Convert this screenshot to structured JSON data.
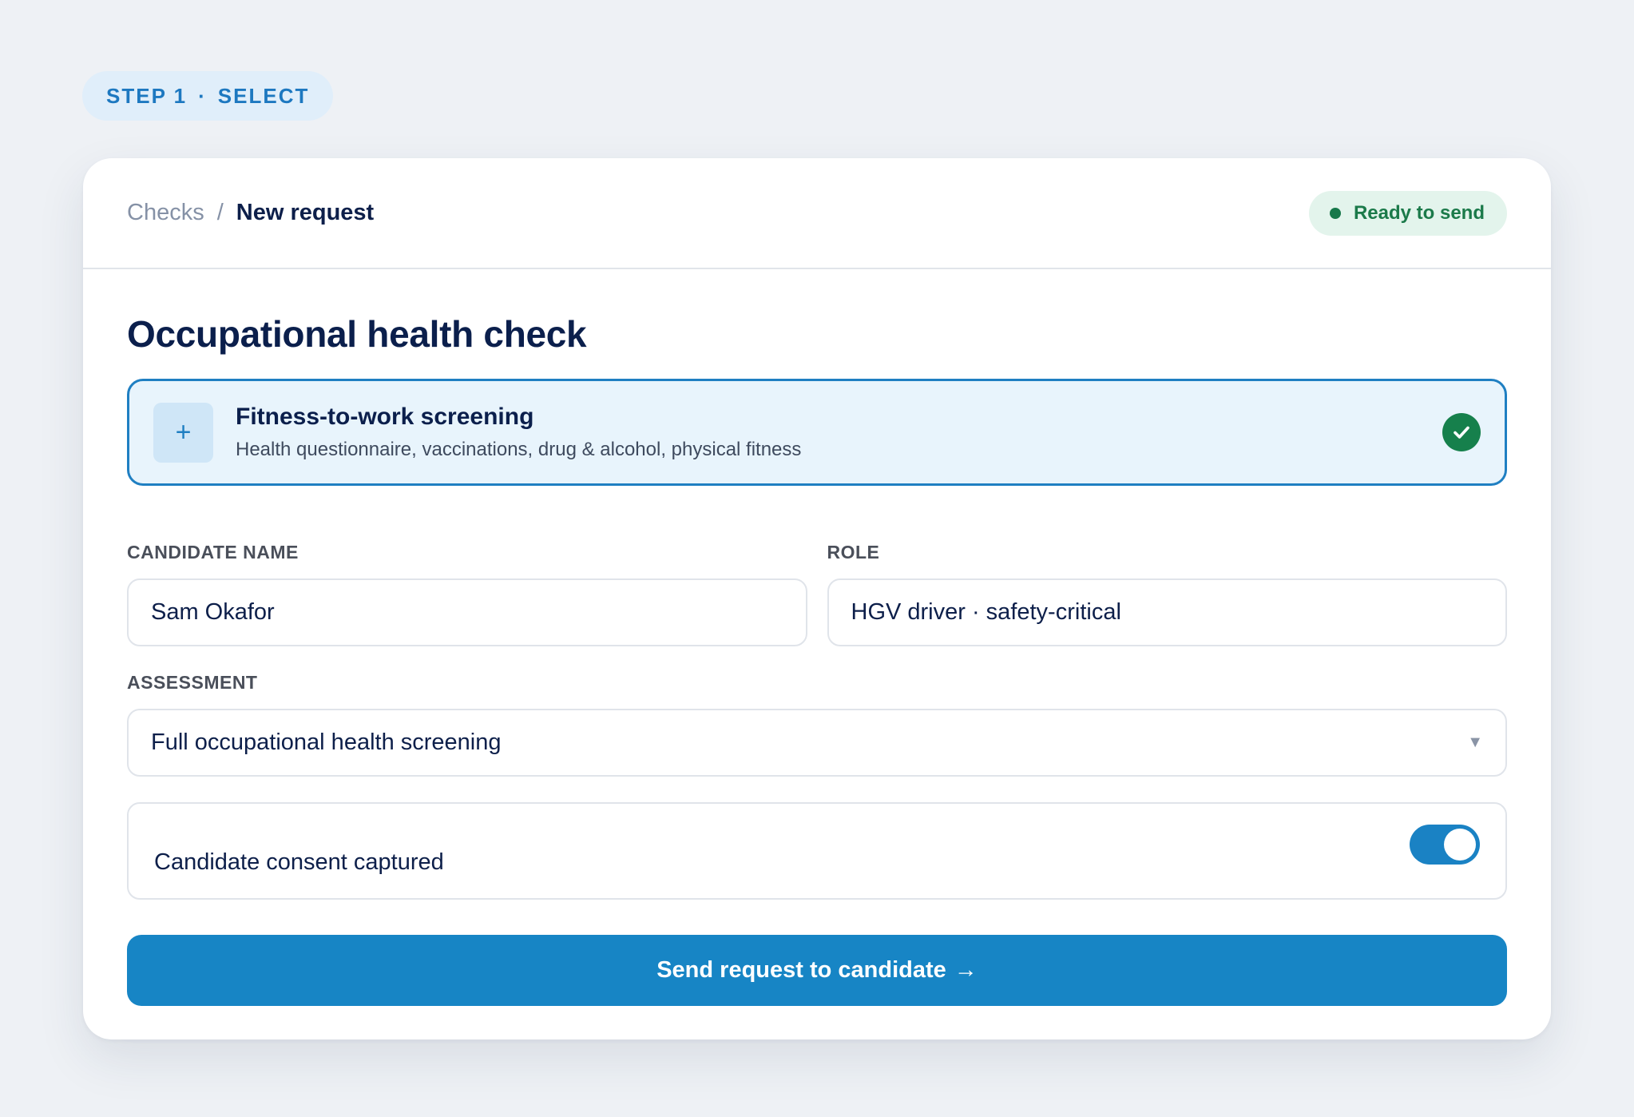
{
  "step": {
    "label": "STEP 1",
    "separator": "·",
    "name": "SELECT"
  },
  "breadcrumb": {
    "root": "Checks",
    "separator": "/",
    "current": "New request"
  },
  "status": {
    "label": "Ready to send",
    "color": "#17784a"
  },
  "title": "Occupational health check",
  "option": {
    "icon": "plus-icon",
    "icon_glyph": "+",
    "title": "Fitness-to-work screening",
    "description": "Health questionnaire, vaccinations, drug & alcohol, physical fitness",
    "selected": true
  },
  "form": {
    "candidate_name": {
      "label": "CANDIDATE NAME",
      "value": "Sam Okafor"
    },
    "role": {
      "label": "ROLE",
      "value": "HGV driver · safety-critical"
    },
    "assessment": {
      "label": "ASSESSMENT",
      "value": "Full occupational health screening",
      "chevron": "▼"
    },
    "consent": {
      "label": "Candidate consent captured",
      "enabled": true
    }
  },
  "action": {
    "label": "Send request to candidate",
    "arrow": "→"
  },
  "colors": {
    "accent": "#1785c5",
    "success": "#16804c",
    "selected_bg": "#e8f4fc"
  }
}
